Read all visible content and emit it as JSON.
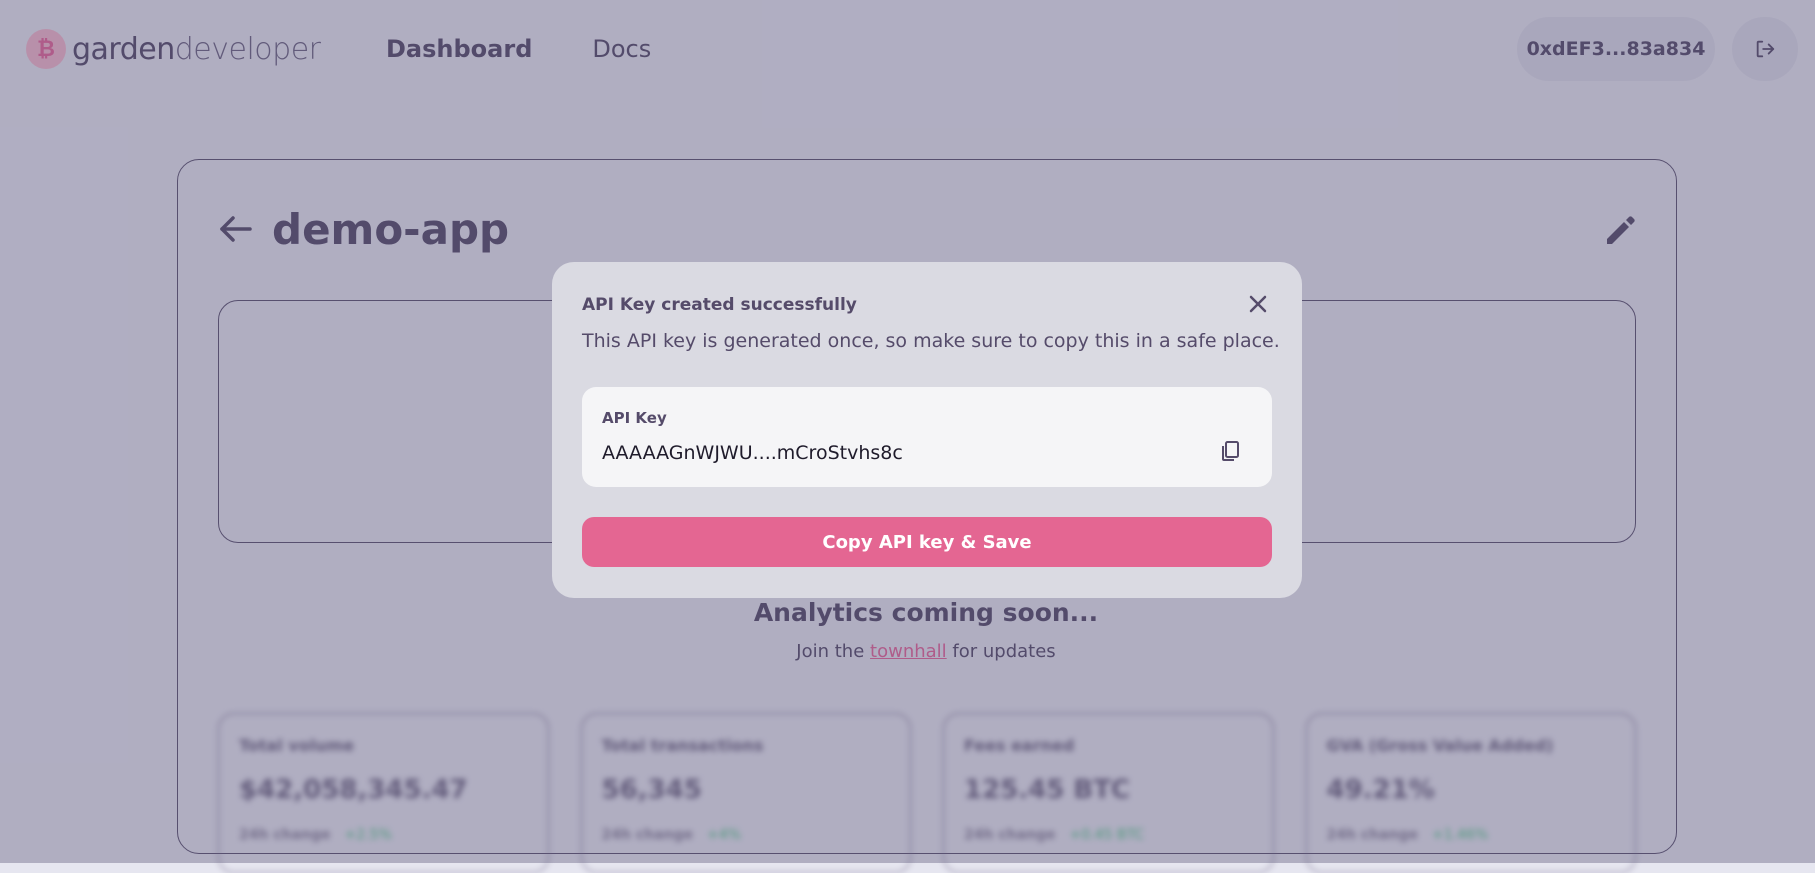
{
  "brand": {
    "name_bold": "garden",
    "name_light": "developer",
    "mark": "₿"
  },
  "nav": {
    "dashboard": "Dashboard",
    "docs": "Docs"
  },
  "wallet": {
    "address": "0xdEF3...83a834"
  },
  "app": {
    "title": "demo-app"
  },
  "analytics": {
    "heading": "Analytics coming soon...",
    "join_prefix": "Join the",
    "join_link": "townhall",
    "join_suffix": "for updates"
  },
  "stats": [
    {
      "label": "Total volume",
      "value": "$42,058,345.47",
      "change_label": "24h change",
      "change": "+2.5%"
    },
    {
      "label": "Total transactions",
      "value": "56,345",
      "change_label": "24h change",
      "change": "+4%"
    },
    {
      "label": "Fees earned",
      "value": "125.45 BTC",
      "change_label": "24h change",
      "change": "+0.45 BTC"
    },
    {
      "label": "GVA (Gross Value Added)",
      "value": "49.21%",
      "change_label": "24h change",
      "change": "+1.46%"
    }
  ],
  "modal": {
    "title": "API Key created successfully",
    "description": "This API key is generated once, so make sure to copy this in a safe place.",
    "key_label": "API Key",
    "key_value": "AAAAAGnWJWU....mCroStvhs8c",
    "button_label": "Copy API key & Save"
  },
  "colors": {
    "accent": "#e46692",
    "text": "#554b6a",
    "positive": "#4fc584"
  }
}
